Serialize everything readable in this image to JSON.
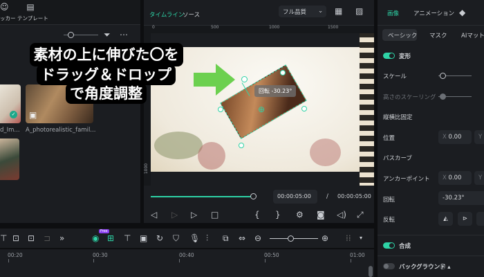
{
  "left": {
    "tools": [
      {
        "label": "ッカー",
        "icon": "sticker-icon"
      },
      {
        "label": "テンプレート",
        "icon": "template-icon"
      }
    ],
    "media": [
      {
        "name": "d_Im..."
      },
      {
        "name": "A_photorealistic_famil..."
      },
      {
        "name": ""
      }
    ]
  },
  "overlay": {
    "lines": [
      "素材の上に伸びた〇を",
      "ドラッグ＆ドロップ",
      "で角度調整"
    ],
    "arrow_color": "#6cd04f"
  },
  "preview": {
    "tabs": [
      "タイムライン",
      "ソース"
    ],
    "quality": "フル品質",
    "ruler": [
      "0",
      "500",
      "1000",
      "1500"
    ],
    "vruler": "1000",
    "rotation_tooltip": "回転 -30.23°",
    "current_time": "00:00:05:00",
    "separator": "/",
    "total_time": "00:00:05:00",
    "progress": 1.0
  },
  "props": {
    "tabs": [
      "画像",
      "アニメーション"
    ],
    "subtabs": [
      "ベーシック",
      "マスク",
      "AIマット"
    ],
    "transform": "変形",
    "scale": "スケール",
    "height_scaling": "高さのスケーリング",
    "aspect": "縦横比固定",
    "position": "位置",
    "pos_x_label": "X",
    "pos_x": "0.00",
    "pos_y_label": "Y",
    "path_curve": "パスカーブ",
    "anchor": "アンカーポイント",
    "anchor_x_label": "X",
    "anchor_x": "0.00",
    "anchor_y_label": "Y",
    "rotation": "回転",
    "rotation_value": "-30.23°",
    "flip": "反転",
    "composite": "合成",
    "background": "バックグラウンド"
  },
  "timeline": {
    "badge": "Free",
    "ticks": [
      "00:20",
      "00:30",
      "00:40",
      "00:50",
      "01:00"
    ]
  },
  "colors": {
    "accent": "#2ed3a6"
  }
}
